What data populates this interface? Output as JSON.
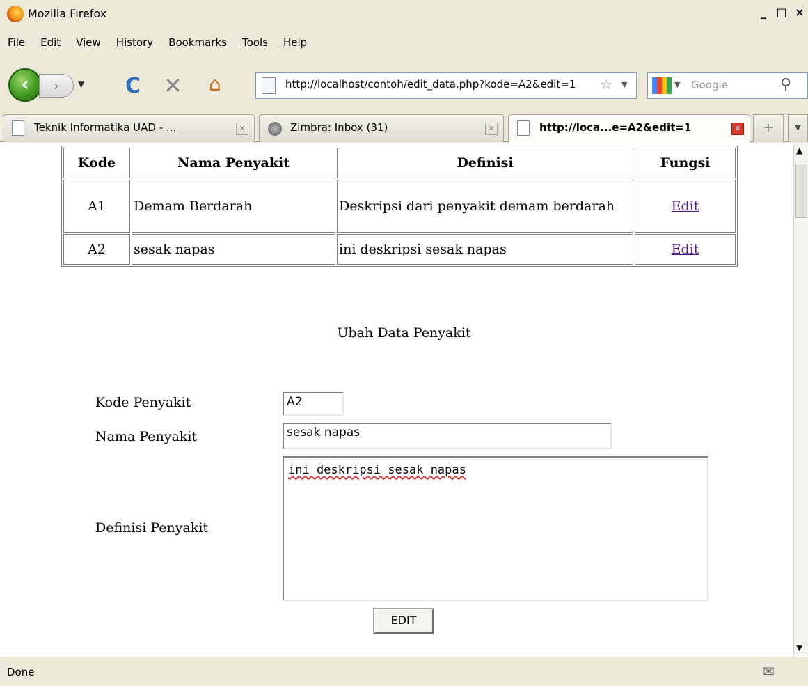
{
  "window": {
    "title": "Mozilla Firefox",
    "controls": [
      "_",
      "□",
      "×"
    ]
  },
  "menu": [
    "File",
    "Edit",
    "View",
    "History",
    "Bookmarks",
    "Tools",
    "Help"
  ],
  "nav": {
    "url": "http://localhost/contoh/edit_data.php?kode=A2&edit=1",
    "search_placeholder": "Google"
  },
  "tabs": [
    {
      "label": "Teknik Informatika UAD - ...",
      "active": false
    },
    {
      "label": "Zimbra: Inbox (31)",
      "active": false
    },
    {
      "label": "http://loca...e=A2&edit=1",
      "active": true
    }
  ],
  "table": {
    "headers": [
      "Kode",
      "Nama Penyakit",
      "Definisi",
      "Fungsi"
    ],
    "rows": [
      {
        "kode": "A1",
        "nama": "Demam Berdarah",
        "definisi": "Deskripsi dari penyakit demam berdarah",
        "fungsi": "Edit"
      },
      {
        "kode": "A2",
        "nama": "sesak napas",
        "definisi": "ini deskripsi sesak napas",
        "fungsi": "Edit"
      }
    ]
  },
  "form": {
    "title": "Ubah Data Penyakit",
    "kode_label": "Kode Penyakit",
    "kode_value": "A2",
    "nama_label": "Nama Penyakit",
    "nama_value": "sesak napas",
    "definisi_label": "Definisi Penyakit",
    "definisi_value": "ini deskripsi sesak napas",
    "submit_label": "EDIT"
  },
  "status": {
    "text": "Done"
  }
}
